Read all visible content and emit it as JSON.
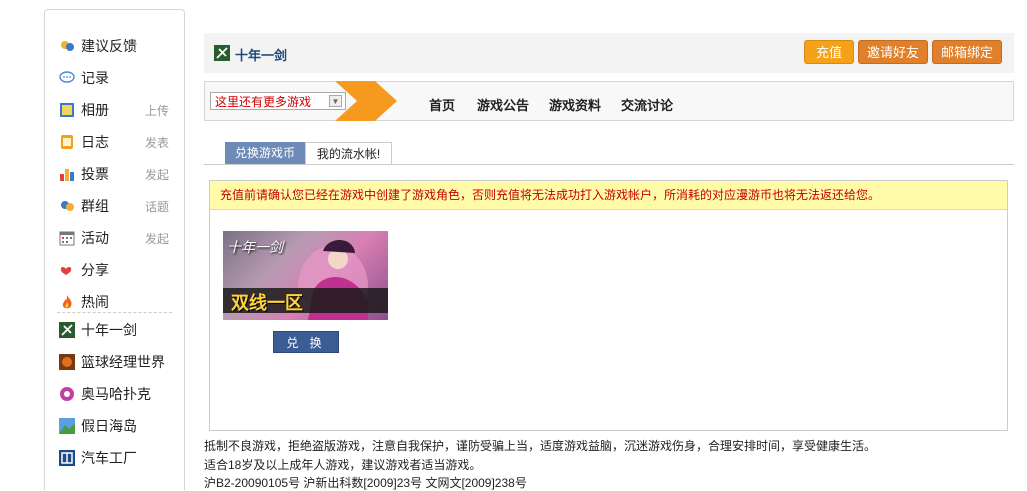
{
  "sidebar": {
    "items": [
      {
        "label": "建议反馈",
        "icon": "chat-bubbles-icon",
        "extra": ""
      },
      {
        "label": "记录",
        "icon": "speech-bubble-icon",
        "extra": ""
      },
      {
        "label": "相册",
        "icon": "photo-album-icon",
        "extra": "上传"
      },
      {
        "label": "日志",
        "icon": "journal-icon",
        "extra": "发表"
      },
      {
        "label": "投票",
        "icon": "bar-chart-icon",
        "extra": "发起"
      },
      {
        "label": "群组",
        "icon": "group-chat-icon",
        "extra": "话题"
      },
      {
        "label": "活动",
        "icon": "calendar-icon",
        "extra": "发起"
      },
      {
        "label": "分享",
        "icon": "share-hearts-icon",
        "extra": ""
      },
      {
        "label": "热闹",
        "icon": "flame-icon",
        "extra": ""
      }
    ],
    "apps": [
      {
        "label": "十年一剑",
        "icon": "sword-game-icon"
      },
      {
        "label": "篮球经理世界",
        "icon": "basketball-game-icon"
      },
      {
        "label": "奥马哈扑克",
        "icon": "poker-game-icon"
      },
      {
        "label": "假日海岛",
        "icon": "island-game-icon"
      },
      {
        "label": "汽车工厂",
        "icon": "car-factory-icon"
      }
    ]
  },
  "header": {
    "game_title": "十年一剑",
    "buttons": {
      "recharge": "充值",
      "invite": "邀请好友",
      "bind_email": "邮箱绑定"
    },
    "colors": {
      "recharge": "#f7a21b",
      "invite": "#e08a2e",
      "bind_email": "#e08a2e"
    }
  },
  "nav": {
    "select_value": "这里还有更多游戏",
    "links": [
      "首页",
      "游戏公告",
      "游戏资料",
      "交流讨论"
    ]
  },
  "tabs": [
    "兑换游戏币",
    "我的流水帐!"
  ],
  "notice": "充值前请确认您已经在游戏中创建了游戏角色，否则充值将无法成功打入游戏帐户，所消耗的对应漫游币也将无法返还给您。",
  "banner": {
    "logo": "十年一剑",
    "server": "双线一区"
  },
  "exchange_button": "兑 换",
  "footer": {
    "line1": "抵制不良游戏，拒绝盗版游戏，注意自我保护，谨防受骗上当，适度游戏益脑，沉迷游戏伤身，合理安排时间，享受健康生活。",
    "line2": "适合18岁及以上成年人游戏，建议游戏者适当游戏。",
    "line3": "沪B2-20090105号 沪新出科数[2009]23号 文网文[2009]238号"
  }
}
